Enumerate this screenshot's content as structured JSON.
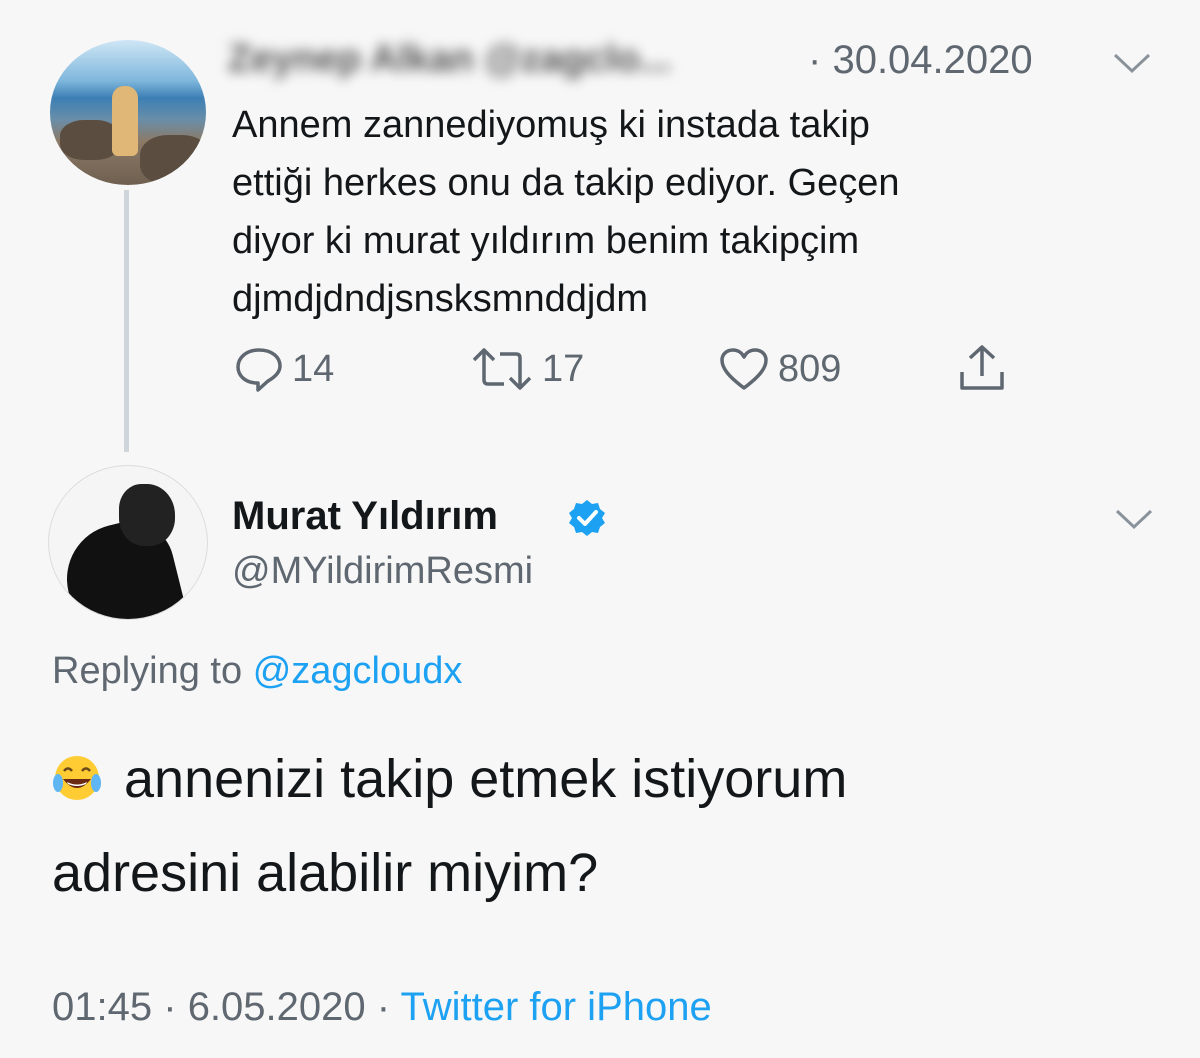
{
  "parent_tweet": {
    "author_blurred": "Zeynep Alkan @zagclo...",
    "separator": "·",
    "date": "30.04.2020",
    "text_lines": [
      "Annem zannediyomuş ki instada takip",
      "ettiği herkes onu da takip ediyor. Geçen",
      "diyor ki murat yıldırım benim takipçim",
      "djmdjdndjsnsksmnddjdm"
    ],
    "actions": {
      "replies": "14",
      "retweets": "17",
      "likes": "809"
    }
  },
  "reply_tweet": {
    "name": "Murat Yıldırım",
    "handle": "@MYildirimResmi",
    "replying_prefix": "Replying to",
    "replying_to": "@zagcloudx",
    "text_line1": "annenizi takip etmek istiyorum",
    "text_line2": "adresini alabilir miyim?",
    "emoji": "face-with-tears-of-joy",
    "time": "01:45",
    "date": "6.05.2020",
    "separator": "·",
    "source": "Twitter for iPhone"
  },
  "colors": {
    "background": "#f7f7f7",
    "text": "#14171a",
    "secondary": "#5f6770",
    "accent": "#1da1f2"
  }
}
